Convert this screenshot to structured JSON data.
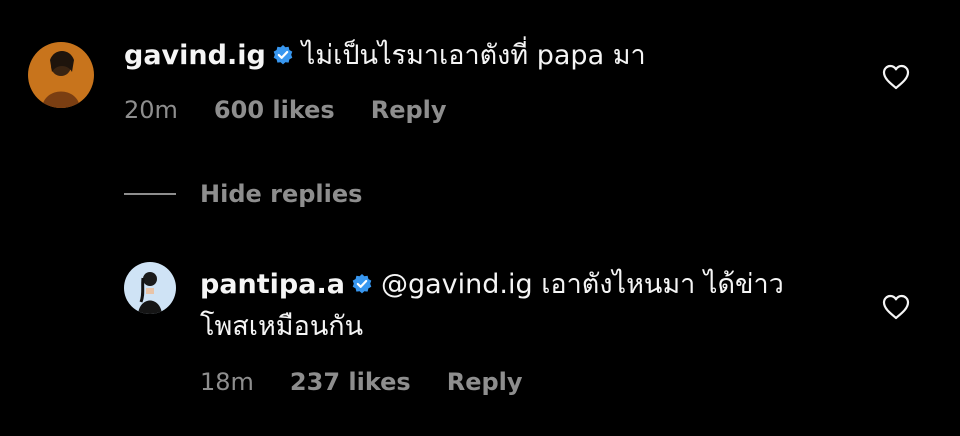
{
  "comments": [
    {
      "username": "gavind.ig",
      "verified": true,
      "text": "ไม่เป็นไรมาเอาตังที่ papa มา",
      "time": "20m",
      "likes": "600 likes",
      "reply": "Reply",
      "avatar_icon": "avatar-gavind",
      "like_icon": "heart-outline-icon"
    }
  ],
  "hide_replies": "Hide replies",
  "replies": [
    {
      "username": "pantipa.a",
      "verified": true,
      "text_line1": "@gavind.ig เอาตังไหนมา ได้ข่าว",
      "text_line2": "โพสเหมือนกัน",
      "time": "18m",
      "likes": "237 likes",
      "reply": "Reply",
      "avatar_icon": "avatar-pantipa",
      "like_icon": "heart-outline-icon"
    }
  ],
  "colors": {
    "background": "#000000",
    "text": "#f5f5f5",
    "muted": "#8e8e8e",
    "verified": "#3897f0"
  }
}
